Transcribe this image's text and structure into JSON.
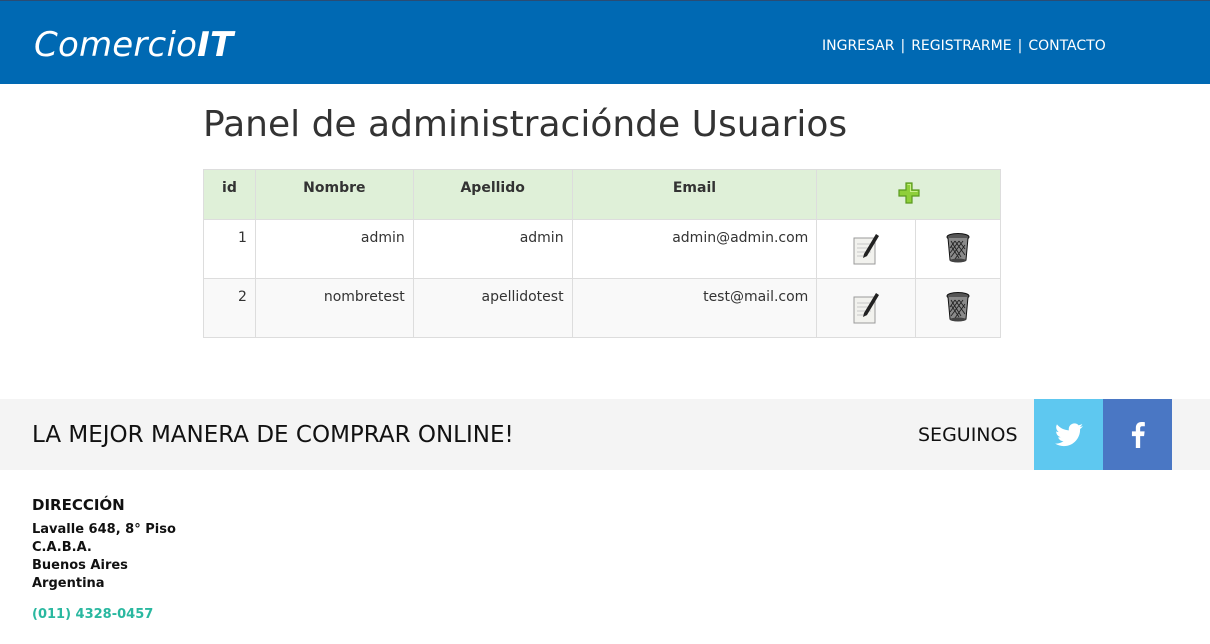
{
  "header": {
    "brand_regular": "Comercio",
    "brand_bold": "IT",
    "nav": [
      "INGRESAR",
      "REGISTRARME",
      "CONTACTO"
    ],
    "separator": "|"
  },
  "page_title": "Panel de administraciónde Usuarios",
  "table": {
    "columns": [
      "id",
      "Nombre",
      "Apellido",
      "Email"
    ],
    "add_icon": "plus-icon",
    "rows": [
      {
        "id": "1",
        "nombre": "admin",
        "apellido": "admin",
        "email": "admin@admin.com"
      },
      {
        "id": "2",
        "nombre": "nombretest",
        "apellido": "apellidotest",
        "email": "test@mail.com"
      }
    ],
    "edit_icon": "edit-icon",
    "delete_icon": "trash-icon"
  },
  "footer": {
    "slogan": "LA MEJOR MANERA DE COMPRAR ONLINE!",
    "follow": "SEGUINOS",
    "social": [
      "twitter-icon",
      "facebook-icon"
    ],
    "address_title": "DIRECCIÓN",
    "address_lines": [
      "Lavalle 648, 8° Piso",
      "C.A.B.A.",
      "Buenos Aires",
      "Argentina"
    ],
    "phone": "(011) 4328-0457"
  },
  "colors": {
    "header_bg": "#0069b3",
    "table_head_bg": "#dff0d8",
    "twitter": "#5ec8f0",
    "facebook": "#4a77c4",
    "phone": "#2ab8a0"
  }
}
